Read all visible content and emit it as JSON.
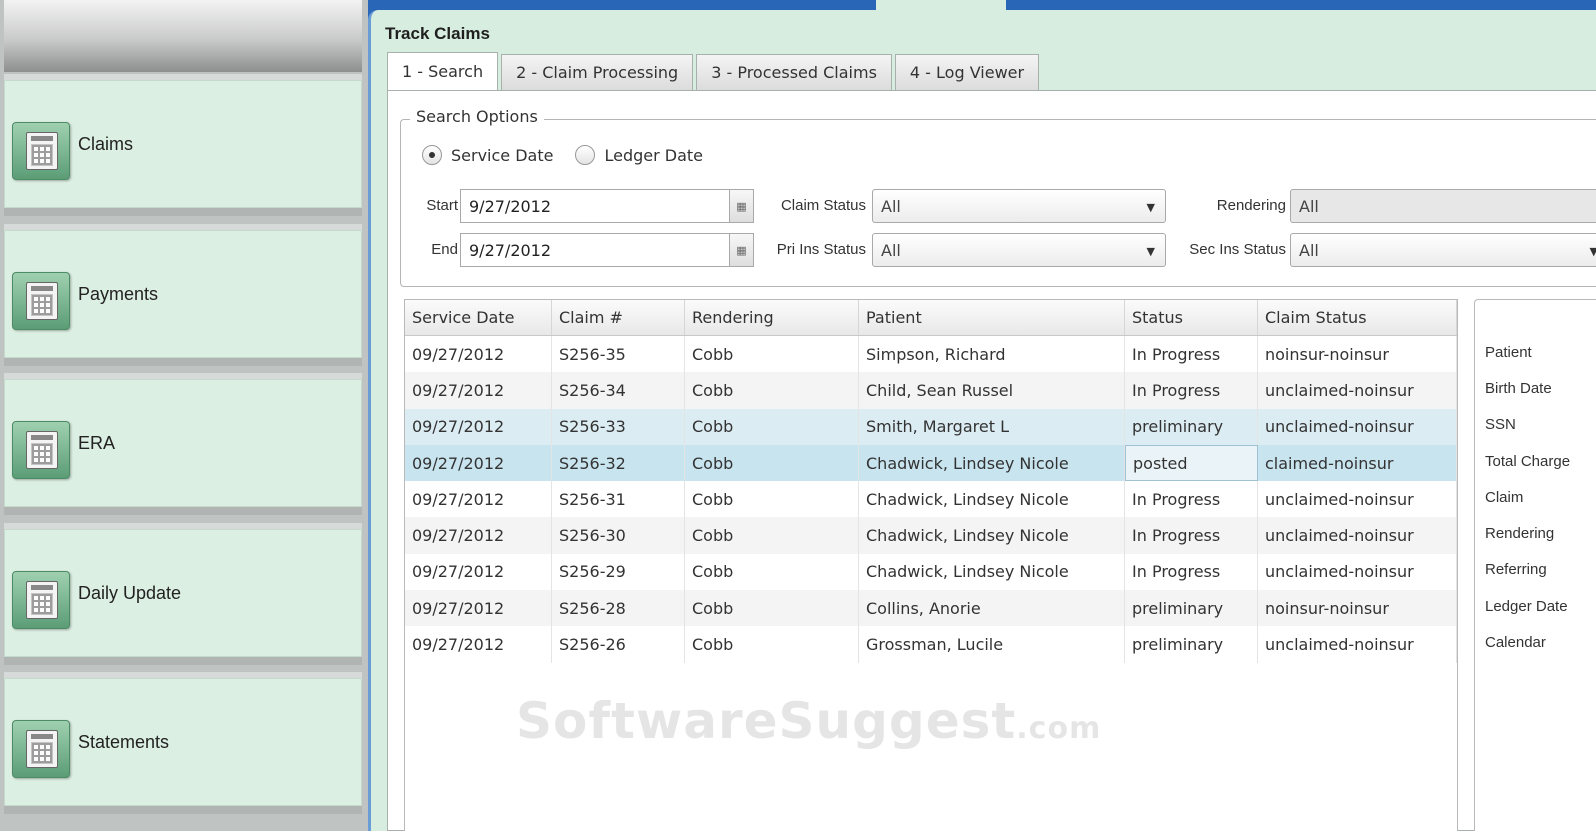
{
  "sidebar": {
    "items": [
      {
        "label": "Claims",
        "icon": "calendar-icon"
      },
      {
        "label": "Payments",
        "icon": "calendar-icon"
      },
      {
        "label": "ERA",
        "icon": "calendar-icon"
      },
      {
        "label": "Daily Update",
        "icon": "calendar-icon"
      },
      {
        "label": "Statements",
        "icon": "calendar-icon"
      }
    ]
  },
  "title": "Track Claims",
  "tabs": [
    {
      "label": "1 - Search",
      "active": true
    },
    {
      "label": "2 - Claim Processing",
      "active": false
    },
    {
      "label": "3 - Processed Claims",
      "active": false
    },
    {
      "label": "4 - Log Viewer",
      "active": false
    }
  ],
  "search": {
    "legend": "Search Options",
    "radio_service": "Service Date",
    "radio_ledger": "Ledger Date",
    "selected_radio": "Service Date",
    "start_label": "Start",
    "start_value": "9/27/2012",
    "end_label": "End",
    "end_value": "9/27/2012",
    "claim_status_label": "Claim Status",
    "claim_status_value": "All",
    "pri_ins_label": "Pri Ins Status",
    "pri_ins_value": "All",
    "rendering_label": "Rendering",
    "rendering_value": "All",
    "sec_ins_label": "Sec Ins Status",
    "sec_ins_value": "All"
  },
  "table": {
    "columns": [
      "Service Date",
      "Claim #",
      "Rendering",
      "Patient",
      "Status",
      "Claim Status"
    ],
    "rows": [
      [
        "09/27/2012",
        "S256-35",
        "Cobb",
        "Simpson, Richard",
        "In Progress",
        "noinsur-noinsur"
      ],
      [
        "09/27/2012",
        "S256-34",
        "Cobb",
        "Child, Sean Russel",
        "In Progress",
        "unclaimed-noinsur"
      ],
      [
        "09/27/2012",
        "S256-33",
        "Cobb",
        "Smith, Margaret L",
        "preliminary",
        "unclaimed-noinsur"
      ],
      [
        "09/27/2012",
        "S256-32",
        "Cobb",
        "Chadwick, Lindsey Nicole",
        "posted",
        "claimed-noinsur"
      ],
      [
        "09/27/2012",
        "S256-31",
        "Cobb",
        "Chadwick, Lindsey Nicole",
        "In Progress",
        "unclaimed-noinsur"
      ],
      [
        "09/27/2012",
        "S256-30",
        "Cobb",
        "Chadwick, Lindsey Nicole",
        "In Progress",
        "unclaimed-noinsur"
      ],
      [
        "09/27/2012",
        "S256-29",
        "Cobb",
        "Chadwick, Lindsey Nicole",
        "In Progress",
        "unclaimed-noinsur"
      ],
      [
        "09/27/2012",
        "S256-28",
        "Cobb",
        "Collins, Anorie",
        "preliminary",
        "noinsur-noinsur"
      ],
      [
        "09/27/2012",
        "S256-26",
        "Cobb",
        "Grossman, Lucile",
        "preliminary",
        "unclaimed-noinsur"
      ]
    ],
    "hover_row": 2,
    "selected_row": 3
  },
  "detail": {
    "labels": [
      "Patient",
      "Birth Date",
      "SSN",
      "Total Charge",
      "Claim",
      "Rendering",
      "Referring",
      "Ledger Date",
      "Calendar"
    ]
  },
  "watermark": {
    "main": "SoftwareSuggest",
    "suffix": ".com"
  }
}
